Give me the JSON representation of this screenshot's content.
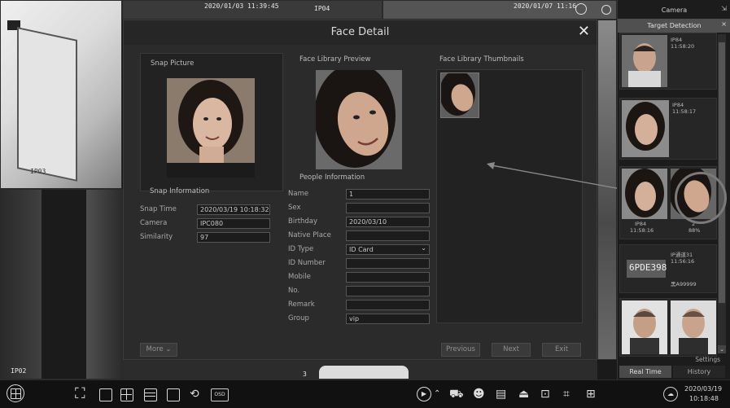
{
  "camera_grid": {
    "top_left": {
      "name": "IP03"
    },
    "top_middle": {
      "timestamp": "2020/01/03 11:39:45",
      "name": "IP04"
    },
    "top_right": {
      "timestamp": "2020/01/07 11:16"
    },
    "bottom_left": {
      "name": "IP02"
    },
    "bottom_middle": {
      "number": "3"
    }
  },
  "dialog": {
    "title": "Face Detail",
    "snap_picture": {
      "title": "Snap Picture"
    },
    "snap_information": {
      "title": "Snap Information",
      "rows": [
        {
          "label": "Snap Time",
          "value": "2020/03/19 10:18:32"
        },
        {
          "label": "Camera",
          "value": "IPC080"
        },
        {
          "label": "Similarity",
          "value": "97"
        }
      ]
    },
    "face_library_preview": {
      "title": "Face Library Preview"
    },
    "people_information": {
      "title": "People Information",
      "rows": [
        {
          "label": "Name",
          "value": "1"
        },
        {
          "label": "Sex",
          "value": ""
        },
        {
          "label": "Birthday",
          "value": "2020/03/10"
        },
        {
          "label": "Native Place",
          "value": ""
        },
        {
          "label": "ID Type",
          "value": "ID Card"
        },
        {
          "label": "ID Number",
          "value": ""
        },
        {
          "label": "Mobile",
          "value": ""
        },
        {
          "label": "No.",
          "value": ""
        },
        {
          "label": "Remark",
          "value": ""
        },
        {
          "label": "Group",
          "value": "vip"
        }
      ]
    },
    "face_library_thumbnails": {
      "title": "Face Library Thumbnails"
    },
    "buttons": {
      "more": "More",
      "previous": "Previous",
      "next": "Next",
      "exit": "Exit"
    }
  },
  "right_panel": {
    "camera_tab": "Camera",
    "target_detection_tab": "Target Detection",
    "cards": [
      {
        "line1": "IP84",
        "line2": "11:58:20"
      },
      {
        "line1": "IP84",
        "line2": "11:58:17"
      },
      {
        "line1": "IP84",
        "line2": "11:58:16",
        "extra1": "2",
        "extra2": "88%"
      },
      {
        "line1": "IP通道31",
        "line2": "11:56:16",
        "plate": "6PDE398",
        "extra1": "黑A99999"
      },
      {
        "line1": "",
        "line2": ""
      }
    ],
    "settings": "Settings",
    "real_time": "Real Time",
    "history": "History"
  },
  "toolbar": {
    "osd": "OSD",
    "date": "2020/03/19",
    "time": "10:18:48"
  },
  "colors": {
    "dialog_bg": "#2b2b2b",
    "accent_tab": "#555555",
    "annotation": "#7a7a7a"
  }
}
